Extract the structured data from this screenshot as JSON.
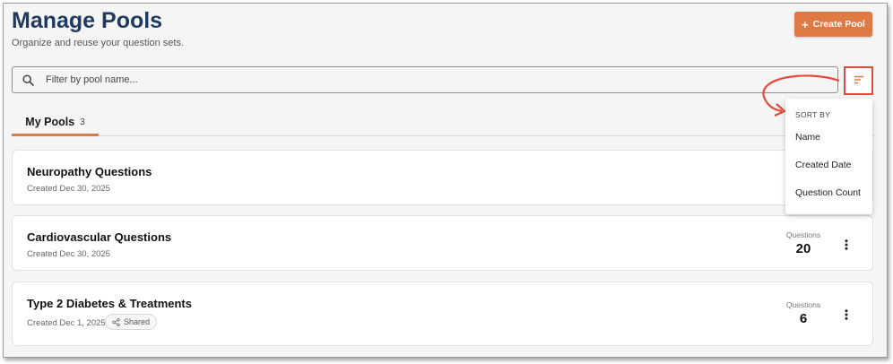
{
  "header": {
    "title": "Manage Pools",
    "subtitle": "Organize and reuse your question sets.",
    "create_button": "Create Pool",
    "create_icon": "+"
  },
  "search": {
    "placeholder": "Filter by pool name..."
  },
  "tabs": [
    {
      "label": "My Pools",
      "count": "3"
    }
  ],
  "sort_menu": {
    "header": "SORT BY",
    "options": [
      "Name",
      "Created Date",
      "Question Count"
    ]
  },
  "pools": [
    {
      "name": "Neuropathy Questions",
      "created": "Created Dec 30, 2025"
    },
    {
      "name": "Cardiovascular Questions",
      "created": "Created Dec 30, 2025",
      "questions_label": "Questions",
      "questions": "20"
    },
    {
      "name": "Type 2 Diabetes & Treatments",
      "created": "Created Dec 1, 2025",
      "shared": "Shared",
      "questions_label": "Questions",
      "questions": "6"
    }
  ],
  "colors": {
    "accent": "#e07a45",
    "title": "#1f3a5f",
    "highlight": "#e04b3a"
  },
  "icons": [
    "search-icon",
    "sort-icon",
    "share-icon",
    "more-vertical-icon",
    "plus-icon"
  ]
}
